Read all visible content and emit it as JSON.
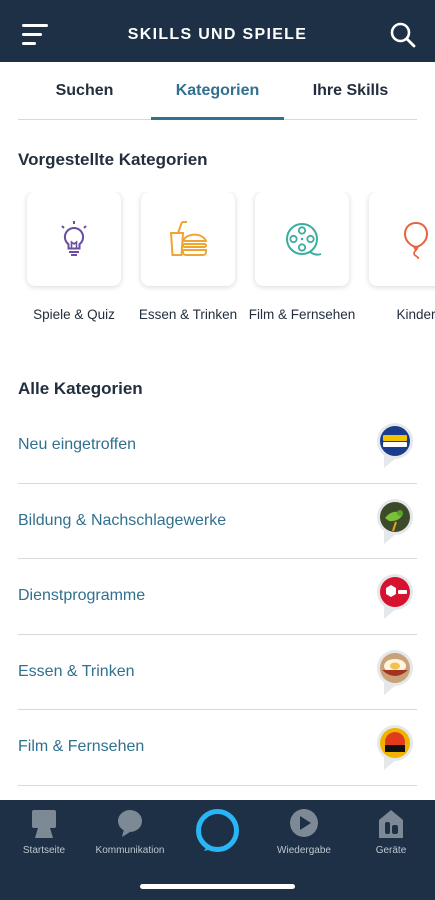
{
  "header": {
    "title": "SKILLS UND SPIELE",
    "menu_icon": "hamburger-menu-icon",
    "search_icon": "search-icon"
  },
  "tabs": [
    {
      "label": "Suchen",
      "active": false
    },
    {
      "label": "Kategorien",
      "active": true
    },
    {
      "label": "Ihre Skills",
      "active": false
    }
  ],
  "featured": {
    "title": "Vorgestellte Kategorien",
    "items": [
      {
        "label": "Spiele & Quiz",
        "icon": "lightbulb-icon",
        "color": "#6b4ea0"
      },
      {
        "label": "Essen & Trinken",
        "icon": "burger-drink-icon",
        "color": "#f0a530"
      },
      {
        "label": "Film & Fernsehen",
        "icon": "film-reel-icon",
        "color": "#3aaea0"
      },
      {
        "label": "Kinder",
        "icon": "balloon-icon",
        "color": "#e8603c"
      }
    ]
  },
  "all": {
    "title": "Alle Kategorien",
    "items": [
      {
        "label": "Neu eingetroffen",
        "thumb": "antenne-bayern-logo"
      },
      {
        "label": "Bildung & Nachschlagewerke",
        "thumb": "bird-photo"
      },
      {
        "label": "Dienstprogramme",
        "thumb": "dpd-logo"
      },
      {
        "label": "Essen & Trinken",
        "thumb": "food-bowl-photo"
      },
      {
        "label": "Film & Fernsehen",
        "thumb": "tv-digital-logo"
      }
    ]
  },
  "bottom_nav": [
    {
      "label": "Startseite",
      "icon": "home-icon"
    },
    {
      "label": "Kommunikation",
      "icon": "chat-bubble-icon"
    },
    {
      "label": "",
      "icon": "alexa-ring-icon"
    },
    {
      "label": "Wiedergabe",
      "icon": "play-icon"
    },
    {
      "label": "Geräte",
      "icon": "devices-icon"
    }
  ],
  "colors": {
    "header_bg": "#1d3045",
    "accent": "#31708f",
    "alexa_ring": "#29b6f6"
  }
}
